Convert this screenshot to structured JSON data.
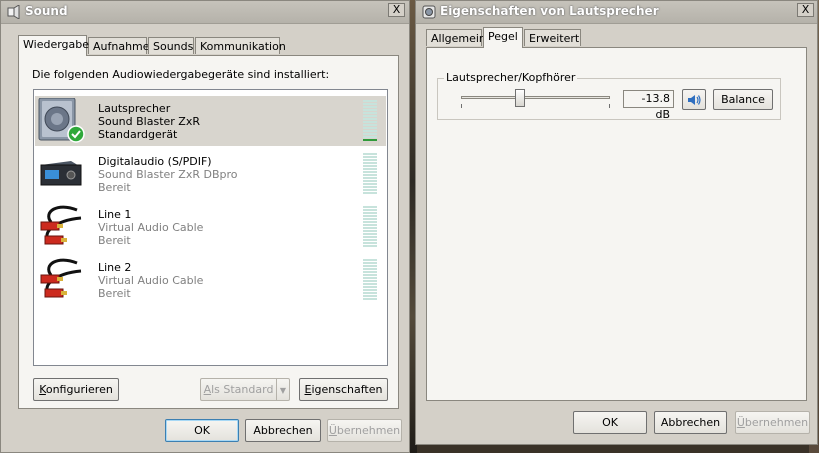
{
  "sound_window": {
    "title": "Sound",
    "close_label": "X",
    "tabs": [
      {
        "label": "Wiedergabe",
        "active": true
      },
      {
        "label": "Aufnahme",
        "active": false
      },
      {
        "label": "Sounds",
        "active": false
      },
      {
        "label": "Kommunikation",
        "active": false
      }
    ],
    "instruction": "Die folgenden Audiowiedergabegeräte sind installiert:",
    "devices": [
      {
        "name": "Lautsprecher",
        "driver": "Sound Blaster ZxR",
        "status": "Standardgerät",
        "icon": "speaker-icon",
        "selected": true,
        "default": true,
        "meter_level": 0.1
      },
      {
        "name": "Digitalaudio (S/PDIF)",
        "driver": "Sound Blaster ZxR DBpro",
        "status": "Bereit",
        "icon": "digital-audio-icon",
        "selected": false,
        "default": false,
        "meter_level": 0
      },
      {
        "name": "Line 1",
        "driver": "Virtual Audio Cable",
        "status": "Bereit",
        "icon": "cable-icon",
        "selected": false,
        "default": false,
        "meter_level": 0
      },
      {
        "name": "Line 2",
        "driver": "Virtual Audio Cable",
        "status": "Bereit",
        "icon": "cable-icon",
        "selected": false,
        "default": false,
        "meter_level": 0
      }
    ],
    "buttons": {
      "configure": "Konfigurieren",
      "set_default": "Als Standard",
      "properties": "Eigenschaften",
      "ok": "OK",
      "cancel": "Abbrechen",
      "apply": "Übernehmen"
    }
  },
  "properties_window": {
    "title": "Eigenschaften von Lautsprecher",
    "close_label": "X",
    "tabs": [
      {
        "label": "Allgemein",
        "active": false
      },
      {
        "label": "Pegel",
        "active": true
      },
      {
        "label": "Erweitert",
        "active": false
      }
    ],
    "group_label": "Lautsprecher/Kopfhörer",
    "level_value": "-13.8 dB",
    "level_fraction": 0.39,
    "buttons": {
      "balance": "Balance",
      "ok": "OK",
      "cancel": "Abbrechen",
      "apply": "Übernehmen"
    }
  },
  "colors": {
    "meter_empty": "#c7e3dc",
    "meter_active": "#2f9a3a",
    "selection": "#d8d5ce",
    "default_check": "#2fa83a"
  }
}
